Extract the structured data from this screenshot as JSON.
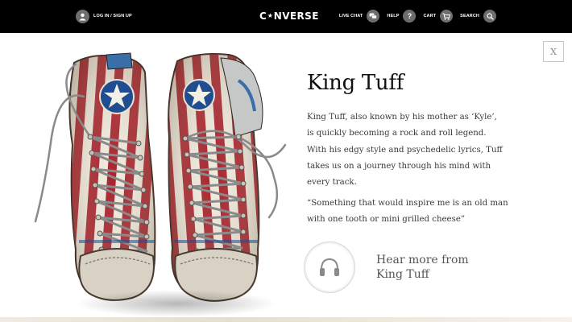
{
  "header": {
    "login_label": "LOG IN / SIGN UP",
    "brand": [
      "C",
      "NVERSE"
    ],
    "nav": [
      {
        "label": "LIVE CHAT",
        "icon": "chat-icon"
      },
      {
        "label": "HELP",
        "icon": "help-icon",
        "glyph": "?"
      },
      {
        "label": "CART",
        "icon": "cart-icon"
      },
      {
        "label": "SEARCH",
        "icon": "search-icon"
      }
    ]
  },
  "panel": {
    "close_label": "X",
    "title": "King Tuff",
    "paragraph": "King Tuff, also known by his mother as ‘Kyle’, is quickly becoming a rock and roll legend. With his edgy style and psychedelic lyrics, Tuff takes us on a journey through his mind with every track.",
    "quote": "“Something that would inspire me is an old man with one tooth or mini grilled cheese”",
    "hear_more": "Hear more from King Tuff"
  },
  "colors": {
    "topbar": "#000000",
    "icon_circle": "#6e6e6e",
    "stripe_red": "#a8232c",
    "star_blue": "#1f4d8f",
    "canvas_white": "#efe9dc",
    "rubber": "#d8d2c4"
  }
}
